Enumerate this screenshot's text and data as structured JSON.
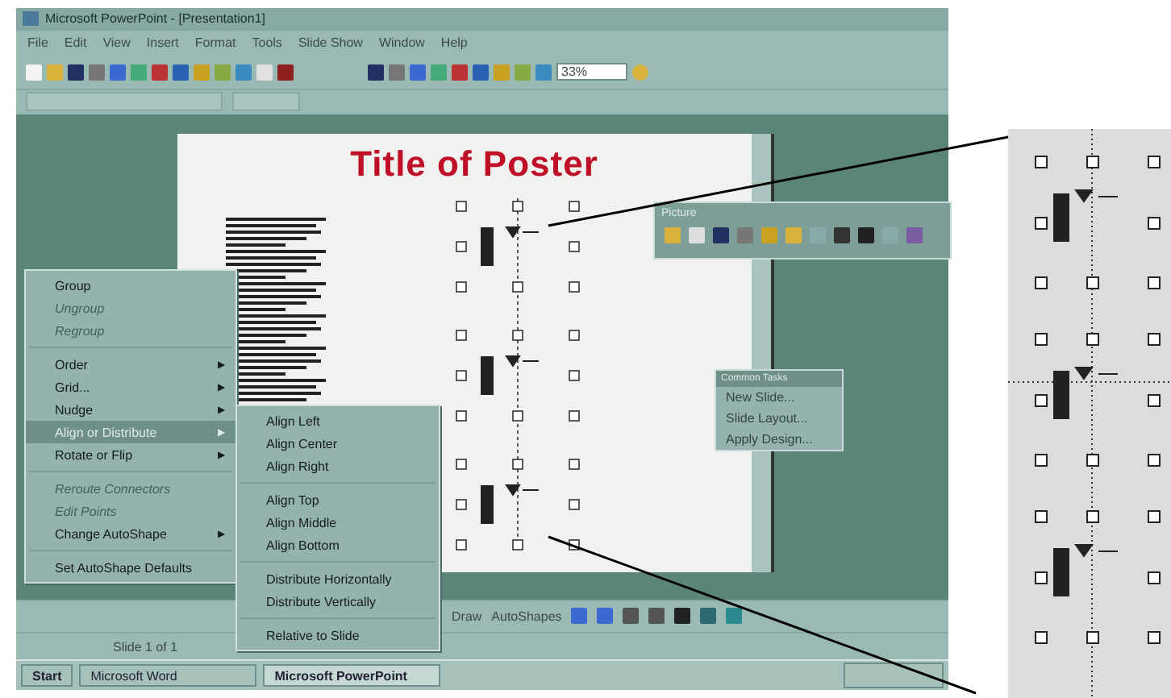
{
  "window": {
    "title": "Microsoft PowerPoint - [Presentation1]"
  },
  "menu_bar": [
    "File",
    "Edit",
    "View",
    "Insert",
    "Format",
    "Tools",
    "Slide Show",
    "Window",
    "Help"
  ],
  "zoom_box": {
    "value": "33%"
  },
  "slide": {
    "title": "Title of Poster"
  },
  "picture_toolbar": {
    "title": "Picture"
  },
  "common_tasks": {
    "title": "Common Tasks",
    "items": [
      "New Slide...",
      "Slide Layout...",
      "Apply Design..."
    ]
  },
  "context_menu": [
    {
      "kind": "item",
      "label": "Group",
      "disabled": false,
      "selected": false
    },
    {
      "kind": "item",
      "label": "Ungroup",
      "disabled": true,
      "selected": false
    },
    {
      "kind": "item",
      "label": "Regroup",
      "disabled": true,
      "selected": false
    },
    {
      "kind": "separator"
    },
    {
      "kind": "item",
      "label": "Order",
      "disabled": false,
      "selected": false,
      "arrow": "▶"
    },
    {
      "kind": "item",
      "label": "Grid...",
      "disabled": false,
      "selected": false,
      "arrow": "▶"
    },
    {
      "kind": "item",
      "label": "Nudge",
      "disabled": false,
      "selected": false,
      "arrow": "▶"
    },
    {
      "kind": "item",
      "label": "Align or Distribute",
      "disabled": false,
      "selected": true,
      "arrow": "▶"
    },
    {
      "kind": "item",
      "label": "Rotate or Flip",
      "disabled": false,
      "selected": false,
      "arrow": "▶"
    },
    {
      "kind": "separator"
    },
    {
      "kind": "item",
      "label": "Reroute Connectors",
      "disabled": true,
      "selected": false
    },
    {
      "kind": "item",
      "label": "Edit Points",
      "disabled": true,
      "selected": false
    },
    {
      "kind": "item",
      "label": "Change AutoShape",
      "disabled": false,
      "selected": false,
      "arrow": "▶"
    },
    {
      "kind": "separator"
    },
    {
      "kind": "item",
      "label": "Set AutoShape Defaults",
      "disabled": false,
      "selected": false
    }
  ],
  "align_submenu": [
    {
      "kind": "item",
      "label": "Align Left"
    },
    {
      "kind": "item",
      "label": "Align Center"
    },
    {
      "kind": "item",
      "label": "Align Right"
    },
    {
      "kind": "separator"
    },
    {
      "kind": "item",
      "label": "Align Top"
    },
    {
      "kind": "item",
      "label": "Align Middle"
    },
    {
      "kind": "item",
      "label": "Align Bottom"
    },
    {
      "kind": "separator"
    },
    {
      "kind": "item",
      "label": "Distribute Horizontally"
    },
    {
      "kind": "item",
      "label": "Distribute Vertically"
    },
    {
      "kind": "separator"
    },
    {
      "kind": "item",
      "label": "Relative to Slide"
    }
  ],
  "drawing_toolbar": {
    "draw": "Draw",
    "autoshapes": "AutoShapes"
  },
  "status_bar": {
    "slide": "Slide 1 of 1"
  },
  "taskbar": {
    "start": "Start",
    "tasks": [
      {
        "label": "Microsoft Word",
        "selected": false
      },
      {
        "label": "Microsoft PowerPoint",
        "selected": true
      }
    ]
  }
}
